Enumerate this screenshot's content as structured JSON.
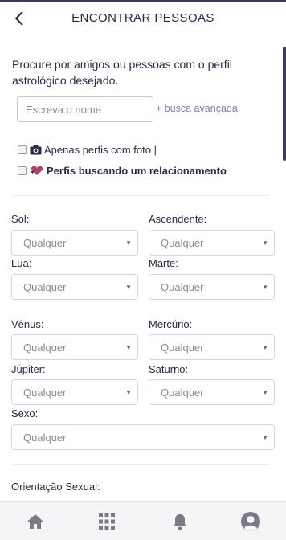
{
  "header": {
    "title": "ENCONTRAR PESSOAS"
  },
  "intro": {
    "text": "Procure por amigos ou pessoas com o perfil astrológico desejado."
  },
  "search": {
    "placeholder": "Escreva o nome",
    "advanced_label": "+ busca avançada"
  },
  "filters": {
    "photo_only": {
      "label": "Apenas perfis com foto |",
      "icon": "camera-icon"
    },
    "seeking_relationship": {
      "label": "Perfis buscando um relacionamento",
      "icon": "heart-icon"
    }
  },
  "fields": {
    "sol": {
      "label": "Sol:",
      "value": "Qualquer"
    },
    "ascendente": {
      "label": "Ascendente:",
      "value": "Qualquer"
    },
    "lua": {
      "label": "Lua:",
      "value": "Qualquer"
    },
    "marte": {
      "label": "Marte:",
      "value": "Qualquer"
    },
    "venus": {
      "label": "Vênus:",
      "value": "Qualquer"
    },
    "mercurio": {
      "label": "Mercúrio:",
      "value": "Qualquer"
    },
    "jupiter": {
      "label": "Júpiter:",
      "value": "Qualquer"
    },
    "saturno": {
      "label": "Saturno:",
      "value": "Qualquer"
    },
    "sexo": {
      "label": "Sexo:",
      "value": "Qualquer"
    }
  },
  "orientation": {
    "label": "Orientação Sexual:"
  },
  "nav": {
    "items": [
      "home-icon",
      "grid-icon",
      "bell-icon",
      "profile-icon"
    ]
  },
  "colors": {
    "accent": "#8a7ab8",
    "text": "#2a2a45",
    "placeholder": "#8a8a99"
  }
}
